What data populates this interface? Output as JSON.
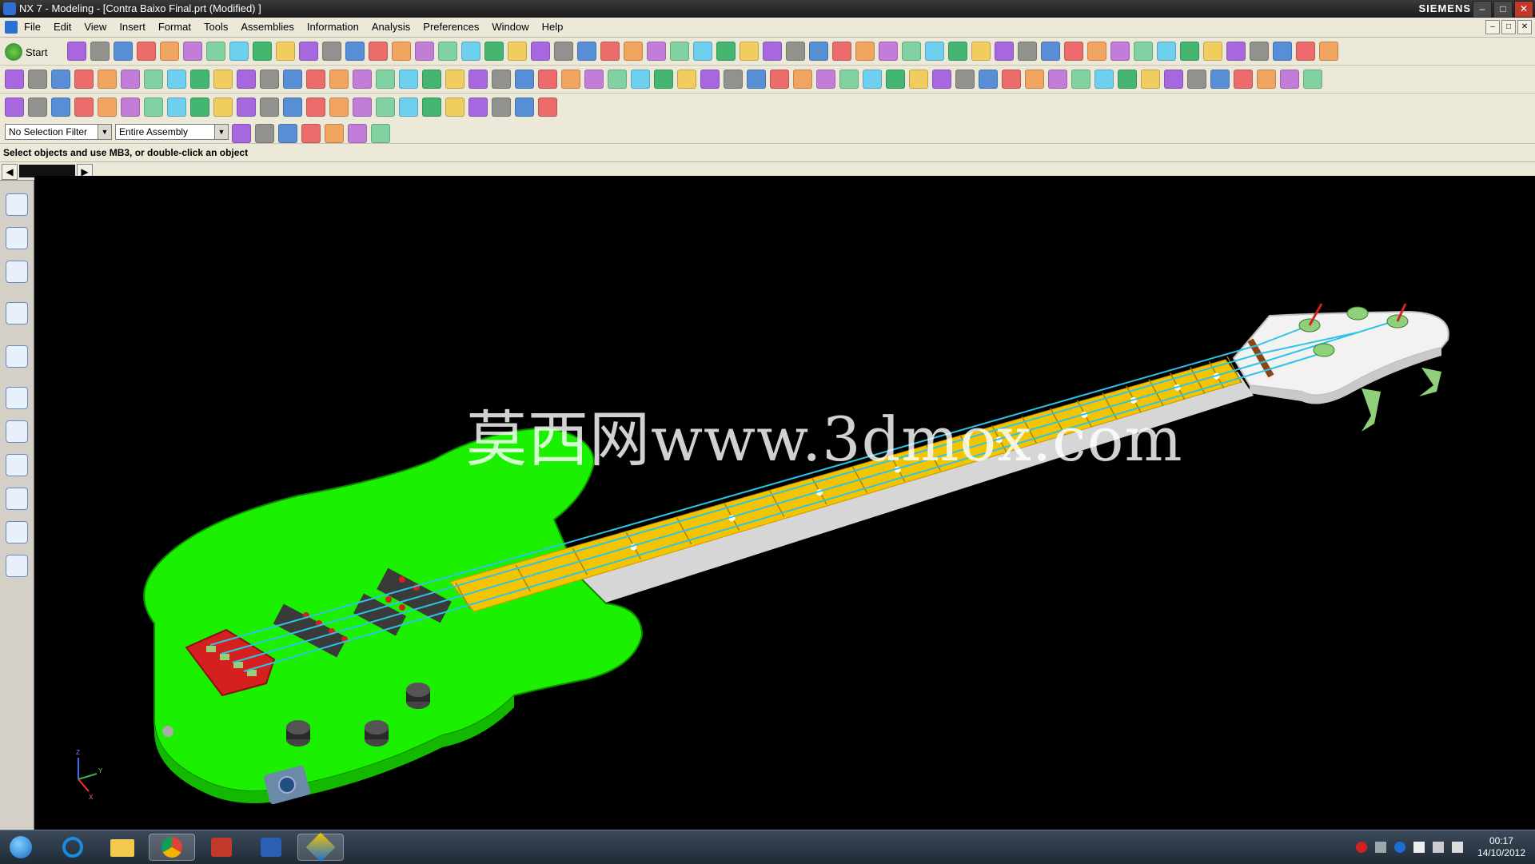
{
  "window": {
    "title": "NX 7 - Modeling - [Contra Baixo Final.prt (Modified) ]",
    "brand": "SIEMENS",
    "min_label": "–",
    "max_label": "□",
    "close_label": "✕"
  },
  "menu": {
    "items": [
      "File",
      "Edit",
      "View",
      "Insert",
      "Format",
      "Tools",
      "Assemblies",
      "Information",
      "Analysis",
      "Preferences",
      "Window",
      "Help"
    ]
  },
  "toolbar": {
    "start_label": "Start"
  },
  "filters": {
    "selection_filter": "No Selection Filter",
    "scope": "Entire Assembly"
  },
  "status": {
    "message": "Select objects and use MB3, or double-click an object"
  },
  "viewport": {
    "watermark": "莫西网www.3dmox.com",
    "triad": {
      "x_label": "X",
      "y_label": "Y",
      "z_label": "Z"
    },
    "model_colors": {
      "body": "#1bf000",
      "fretboard": "#f5c400",
      "headstock": "#f2f2f2",
      "strings": "#2ec4e6",
      "bridge": "#d62020",
      "pickups": "#3a3a3a",
      "tuners": "#8fd17a"
    }
  },
  "taskbar": {
    "apps": [
      "Start",
      "Internet Explorer",
      "Windows Explorer",
      "Google Chrome",
      "PDF Reader",
      "Microsoft Word",
      "NX 7"
    ],
    "clock_time": "00:17",
    "clock_date": "14/10/2012"
  }
}
